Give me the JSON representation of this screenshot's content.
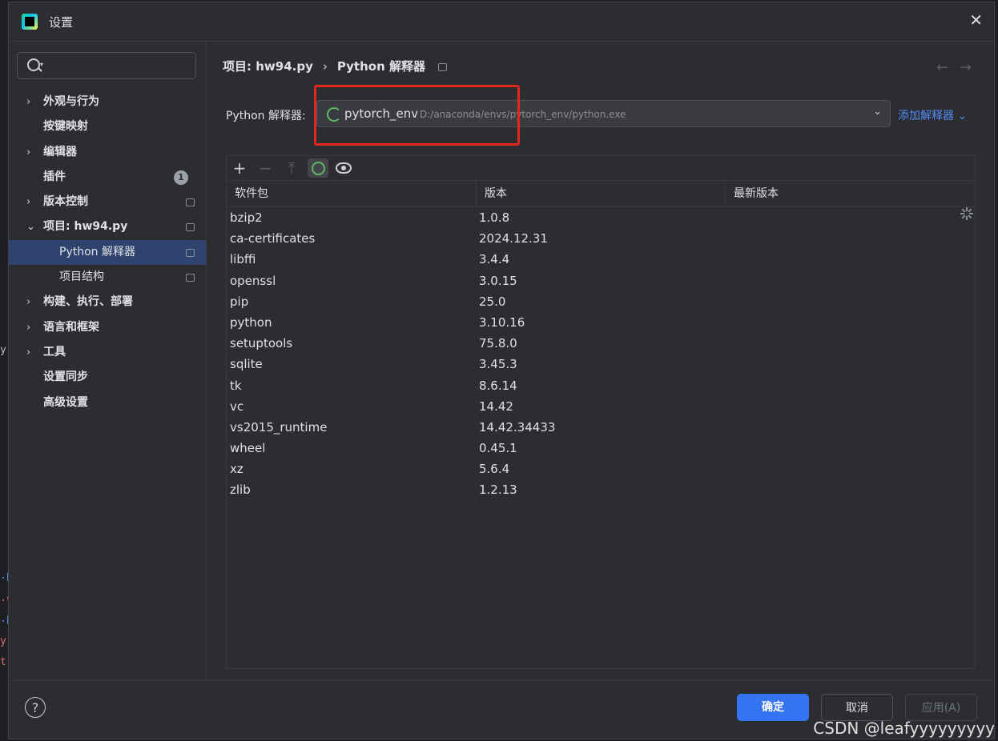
{
  "window": {
    "title": "设置"
  },
  "sidebar": {
    "items": [
      {
        "label": "外观与行为",
        "chevron": "›"
      },
      {
        "label": "按键映射"
      },
      {
        "label": "编辑器",
        "chevron": "›"
      },
      {
        "label": "插件",
        "badge": "1"
      },
      {
        "label": "版本控制",
        "chevron": "›"
      },
      {
        "label": "项目: hw94.py",
        "chevron": "⌄"
      },
      {
        "label": "Python 解释器"
      },
      {
        "label": "项目结构"
      },
      {
        "label": "构建、执行、部署",
        "chevron": "›"
      },
      {
        "label": "语言和框架",
        "chevron": "›"
      },
      {
        "label": "工具",
        "chevron": "›"
      },
      {
        "label": "设置同步"
      },
      {
        "label": "高级设置"
      }
    ]
  },
  "breadcrumb": {
    "project": "项目: hw94.py",
    "separator": "›",
    "page": "Python 解释器"
  },
  "interpreter": {
    "label": "Python 解释器:",
    "env_name": "pytorch_env",
    "env_path": "D:/anaconda/envs/pytorch_env/python.exe",
    "add_label": "添加解释器 ⌄"
  },
  "toolbar": {
    "add": "+",
    "remove": "−",
    "upgrade": "⤒"
  },
  "table": {
    "headers": [
      "软件包",
      "版本",
      "最新版本"
    ],
    "rows": [
      {
        "name": "bzip2",
        "version": "1.0.8",
        "latest": ""
      },
      {
        "name": "ca-certificates",
        "version": "2024.12.31",
        "latest": ""
      },
      {
        "name": "libffi",
        "version": "3.4.4",
        "latest": ""
      },
      {
        "name": "openssl",
        "version": "3.0.15",
        "latest": ""
      },
      {
        "name": "pip",
        "version": "25.0",
        "latest": ""
      },
      {
        "name": "python",
        "version": "3.10.16",
        "latest": ""
      },
      {
        "name": "setuptools",
        "version": "75.8.0",
        "latest": ""
      },
      {
        "name": "sqlite",
        "version": "3.45.3",
        "latest": ""
      },
      {
        "name": "tk",
        "version": "8.6.14",
        "latest": ""
      },
      {
        "name": "vc",
        "version": "14.42",
        "latest": ""
      },
      {
        "name": "vs2015_runtime",
        "version": "14.42.34433",
        "latest": ""
      },
      {
        "name": "wheel",
        "version": "0.45.1",
        "latest": ""
      },
      {
        "name": "xz",
        "version": "5.6.4",
        "latest": ""
      },
      {
        "name": "zlib",
        "version": "1.2.13",
        "latest": ""
      }
    ]
  },
  "footer": {
    "help": "?",
    "ok": "确定",
    "cancel": "取消",
    "apply": "应用(A)"
  },
  "watermark": "CSDN @leafyyyyyyyyy",
  "colors": {
    "accent": "#3574f0",
    "selection": "#2e436e",
    "highlight_box": "#e5261f",
    "link": "#548af7"
  }
}
